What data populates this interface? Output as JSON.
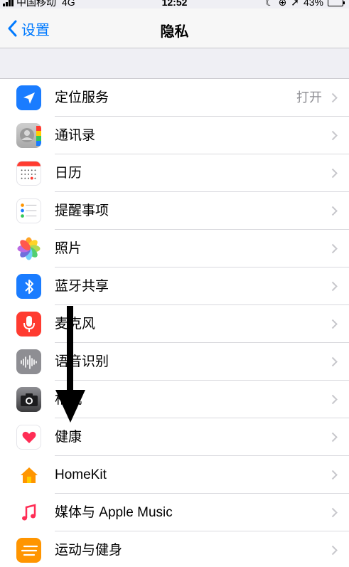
{
  "status_bar": {
    "carrier": "中国移动",
    "network": "4G",
    "time": "12:52",
    "battery": "43%",
    "battery_level": 0.43
  },
  "nav": {
    "back_label": "设置",
    "title": "隐私"
  },
  "rows": [
    {
      "label": "定位服务",
      "value": "打开",
      "icon": "location-arrow-icon",
      "color": "#1a7cff"
    },
    {
      "label": "通讯录",
      "icon": "contacts-icon",
      "color": "#b9b9b9"
    },
    {
      "label": "日历",
      "icon": "calendar-icon",
      "color": "#ffffff"
    },
    {
      "label": "提醒事项",
      "icon": "reminders-icon",
      "color": "#ffffff"
    },
    {
      "label": "照片",
      "icon": "photos-flower-icon",
      "color": "#ffffff"
    },
    {
      "label": "蓝牙共享",
      "icon": "bluetooth-icon",
      "color": "#1a7cff"
    },
    {
      "label": "麦克风",
      "icon": "microphone-icon",
      "color": "#ff3b30"
    },
    {
      "label": "语音识别",
      "icon": "waveform-icon",
      "color": "#8e8e93"
    },
    {
      "label": "相机",
      "icon": "camera-icon",
      "color": "#5f6368"
    },
    {
      "label": "健康",
      "icon": "heart-icon",
      "color": "#ffffff"
    },
    {
      "label": "HomeKit",
      "icon": "home-icon",
      "color": "#ffffff"
    },
    {
      "label": "媒体与 Apple Music",
      "icon": "music-note-icon",
      "color": "#ffffff"
    },
    {
      "label": "运动与健身",
      "icon": "motion-fitness-icon",
      "color": "#ff9500"
    }
  ],
  "annotation": {
    "icon": "down-arrow-icon",
    "color": "#000000"
  }
}
